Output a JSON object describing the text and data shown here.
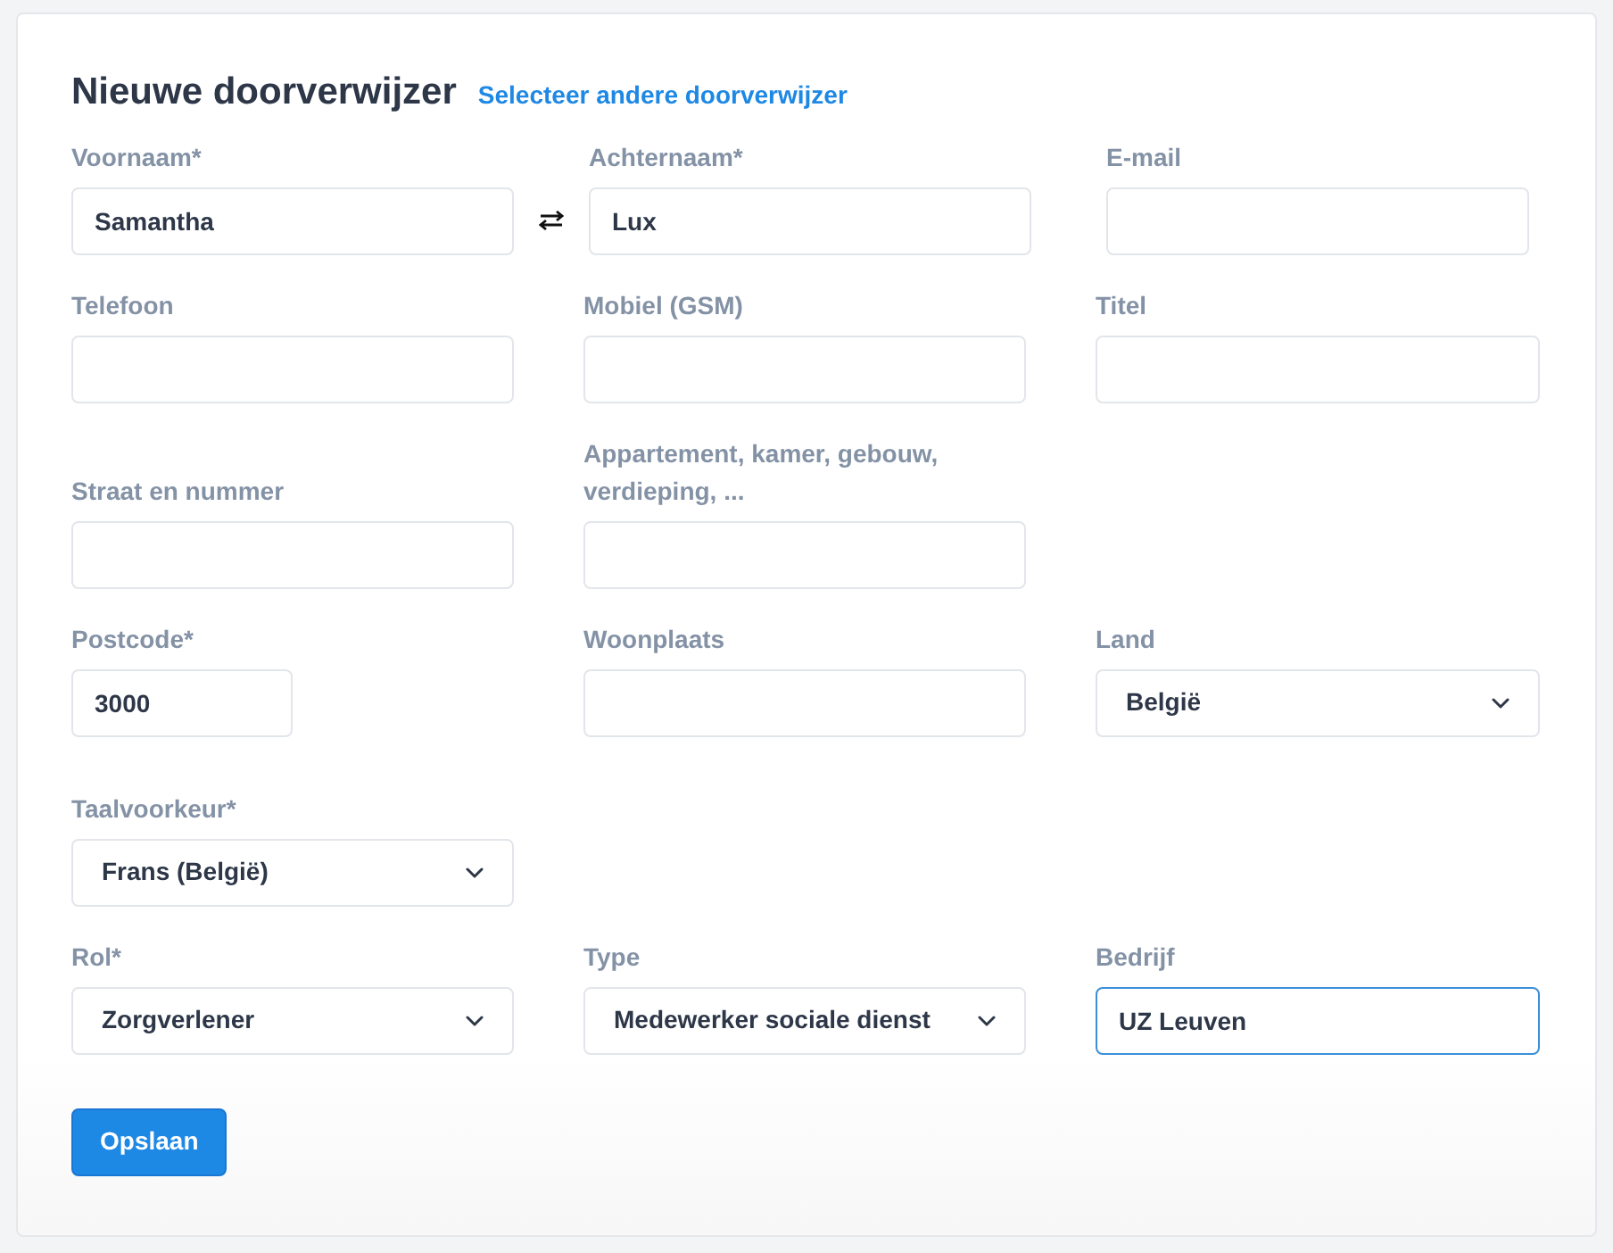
{
  "title": "Nieuwe doorverwijzer",
  "link": "Selecteer andere doorverwijzer",
  "sections": [
    {
      "rows": [
        {
          "swap": true,
          "fields": [
            {
              "label": "Voornaam*",
              "kind": "text",
              "value": "Samantha",
              "focused": false
            },
            {
              "label": "Achternaam*",
              "kind": "text",
              "value": "Lux",
              "focused": false
            },
            {
              "label": "E-mail",
              "kind": "text",
              "focused": false
            }
          ]
        },
        {
          "swap": false,
          "fields": [
            {
              "label": "Telefoon",
              "kind": "text",
              "focused": false
            },
            {
              "label": "Mobiel (GSM)",
              "kind": "text",
              "focused": false
            },
            {
              "label": "Titel",
              "kind": "text",
              "focused": false
            }
          ]
        },
        {
          "swap": false,
          "fields": [
            {
              "label": "Straat en nummer",
              "kind": "text",
              "focused": false
            },
            {
              "label": "Appartement, kamer, gebouw, verdieping, ...",
              "kind": "text",
              "focused": false
            }
          ]
        },
        {
          "swap": false,
          "fields": [
            {
              "label": "Postcode*",
              "kind": "short",
              "value": "3000",
              "focused": false
            },
            {
              "label": "Woonplaats",
              "kind": "text",
              "focused": false
            },
            {
              "label": "Land",
              "kind": "select",
              "value": "België",
              "focused": false
            }
          ]
        }
      ]
    },
    {
      "rows": [
        {
          "swap": false,
          "fields": [
            {
              "label": "Taalvoorkeur*",
              "kind": "select",
              "value": "Frans (België)",
              "focused": false
            }
          ]
        },
        {
          "swap": false,
          "fields": [
            {
              "label": "Rol*",
              "kind": "select",
              "value": "Zorgverlener",
              "focused": false
            },
            {
              "label": "Type",
              "kind": "select",
              "value": "Medewerker sociale dienst",
              "focused": false
            },
            {
              "label": "Bedrijf",
              "kind": "text",
              "value": "UZ Leuven",
              "focused": true
            }
          ]
        }
      ]
    }
  ],
  "button": "Opslaan"
}
